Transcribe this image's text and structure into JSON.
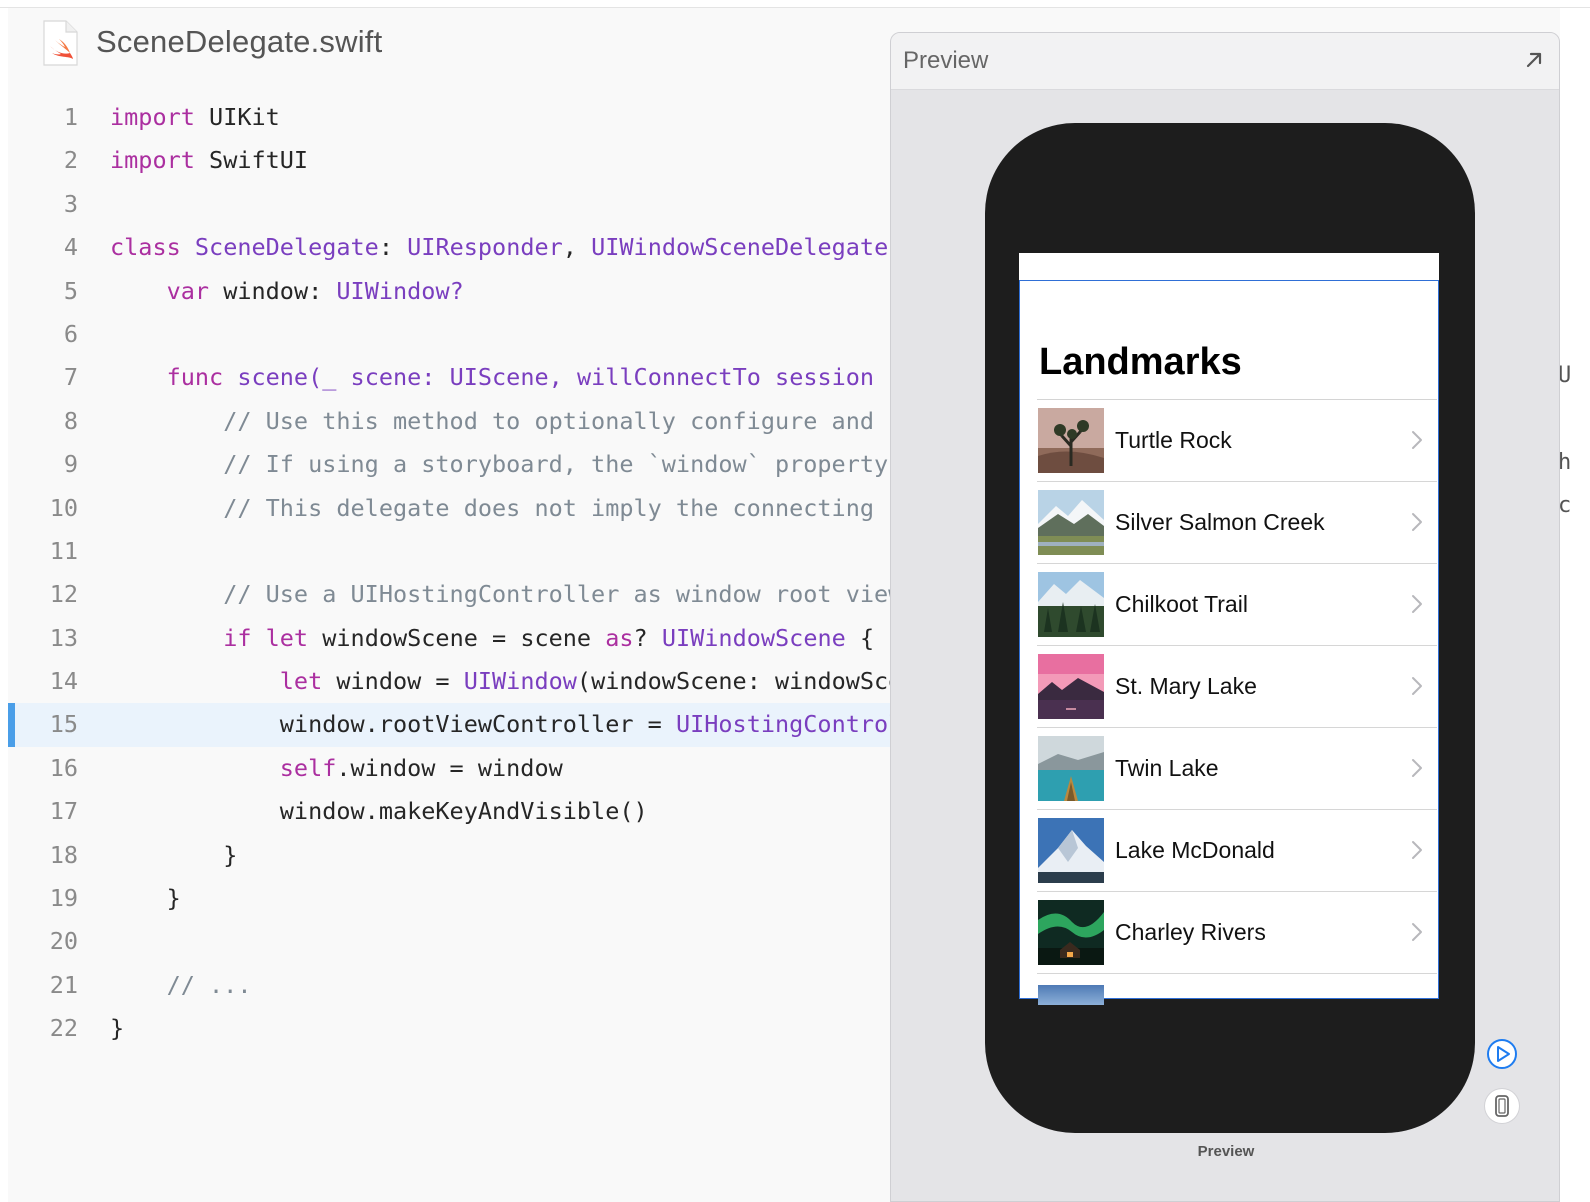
{
  "file": {
    "name": "SceneDelegate.swift",
    "icon": "swift-file-icon"
  },
  "code": {
    "line_numbers": [
      "1",
      "2",
      "3",
      "4",
      "5",
      "6",
      "7",
      "8",
      "9",
      "10",
      "11",
      "12",
      "13",
      "14",
      "15",
      "16",
      "17",
      "18",
      "19",
      "20",
      "21",
      "22"
    ],
    "highlighted_line": 15,
    "lines": [
      {
        "i": "",
        "t": [
          [
            "kw",
            "import"
          ],
          [
            "",
            "UIKit"
          ]
        ]
      },
      {
        "i": "",
        "t": [
          [
            "kw",
            "import"
          ],
          [
            "",
            "SwiftUI"
          ]
        ]
      },
      {
        "i": "",
        "t": []
      },
      {
        "i": "",
        "t": [
          [
            "kw",
            "class"
          ],
          [
            "ty",
            "SceneDelegate"
          ],
          [
            "",
            ":"
          ],
          [
            "ty",
            "UIResponder"
          ],
          [
            "",
            ","
          ],
          [
            "ty",
            "UIWindowSceneDelegate"
          ]
        ]
      },
      {
        "i": "    ",
        "t": [
          [
            "kw",
            "var"
          ],
          [
            "",
            "window:"
          ],
          [
            "ty",
            "UIWindow?"
          ]
        ]
      },
      {
        "i": "",
        "t": []
      },
      {
        "i": "    ",
        "t": [
          [
            "kw",
            "func"
          ],
          [
            "ty",
            "scene(_"
          ],
          [
            "ty",
            "scene:"
          ],
          [
            "ty",
            "UIScene"
          ],
          [
            "ty",
            ","
          ],
          [
            "ty",
            "willConnectTo"
          ],
          [
            "ty",
            "session"
          ]
        ]
      },
      {
        "i": "        ",
        "t": [
          [
            "cm",
            "// Use this method to optionally configure and"
          ]
        ]
      },
      {
        "i": "        ",
        "t": [
          [
            "cm",
            "// If using a storyboard, the `window` property"
          ]
        ]
      },
      {
        "i": "        ",
        "t": [
          [
            "cm",
            "// This delegate does not imply the connecting"
          ]
        ]
      },
      {
        "i": "",
        "t": []
      },
      {
        "i": "        ",
        "t": [
          [
            "cm",
            "// Use a UIHostingController as window root view"
          ]
        ]
      },
      {
        "i": "        ",
        "t": [
          [
            "kw",
            "if"
          ],
          [
            "kw",
            "let"
          ],
          [
            "",
            "windowScene = scene"
          ],
          [
            "kw",
            "as"
          ],
          [
            "",
            "?"
          ],
          [
            "ty",
            "UIWindowScene"
          ],
          [
            "",
            "{"
          ]
        ]
      },
      {
        "i": "            ",
        "t": [
          [
            "kw",
            "let"
          ],
          [
            "",
            "window ="
          ],
          [
            "ty",
            "UIWindow"
          ],
          [
            "",
            "(windowScene: windowScene)"
          ]
        ]
      },
      {
        "i": "            ",
        "t": [
          [
            "",
            "window.rootViewController ="
          ],
          [
            "ty",
            "UIHostingController"
          ]
        ]
      },
      {
        "i": "            ",
        "t": [
          [
            "kw",
            "self"
          ],
          [
            "",
            ".window = window"
          ]
        ]
      },
      {
        "i": "            ",
        "t": [
          [
            "",
            "window.makeKeyAndVisible()"
          ]
        ]
      },
      {
        "i": "        ",
        "t": [
          [
            "",
            "}"
          ]
        ]
      },
      {
        "i": "    ",
        "t": [
          [
            "",
            "}"
          ]
        ]
      },
      {
        "i": "",
        "t": []
      },
      {
        "i": "    ",
        "t": [
          [
            "cm",
            "// ..."
          ]
        ]
      },
      {
        "i": "",
        "t": [
          [
            "",
            "}"
          ]
        ]
      }
    ]
  },
  "preview": {
    "header_title": "Preview",
    "caption": "Preview",
    "expand_icon": "expand-arrow-icon",
    "play_icon": "live-preview-play-icon",
    "device_icon": "device-icon",
    "app": {
      "nav_title": "Landmarks",
      "rows": [
        {
          "name": "Turtle Rock",
          "thumb": "desert-tree"
        },
        {
          "name": "Silver Salmon Creek",
          "thumb": "mountain-meadow"
        },
        {
          "name": "Chilkoot Trail",
          "thumb": "forest-mountain"
        },
        {
          "name": "St. Mary Lake",
          "thumb": "pink-sunset-lake"
        },
        {
          "name": "Twin Lake",
          "thumb": "canoe-lake"
        },
        {
          "name": "Lake McDonald",
          "thumb": "snowy-peak"
        },
        {
          "name": "Charley Rivers",
          "thumb": "aurora-cabin"
        }
      ]
    }
  },
  "right_edge_chars": [
    "U",
    "h",
    "c"
  ],
  "colors": {
    "keyword": "#ab2fa0",
    "type": "#7a3ebf",
    "comment": "#7f8a94",
    "highlight_bar": "#4a9ee8",
    "selection": "#2f6fd6"
  }
}
